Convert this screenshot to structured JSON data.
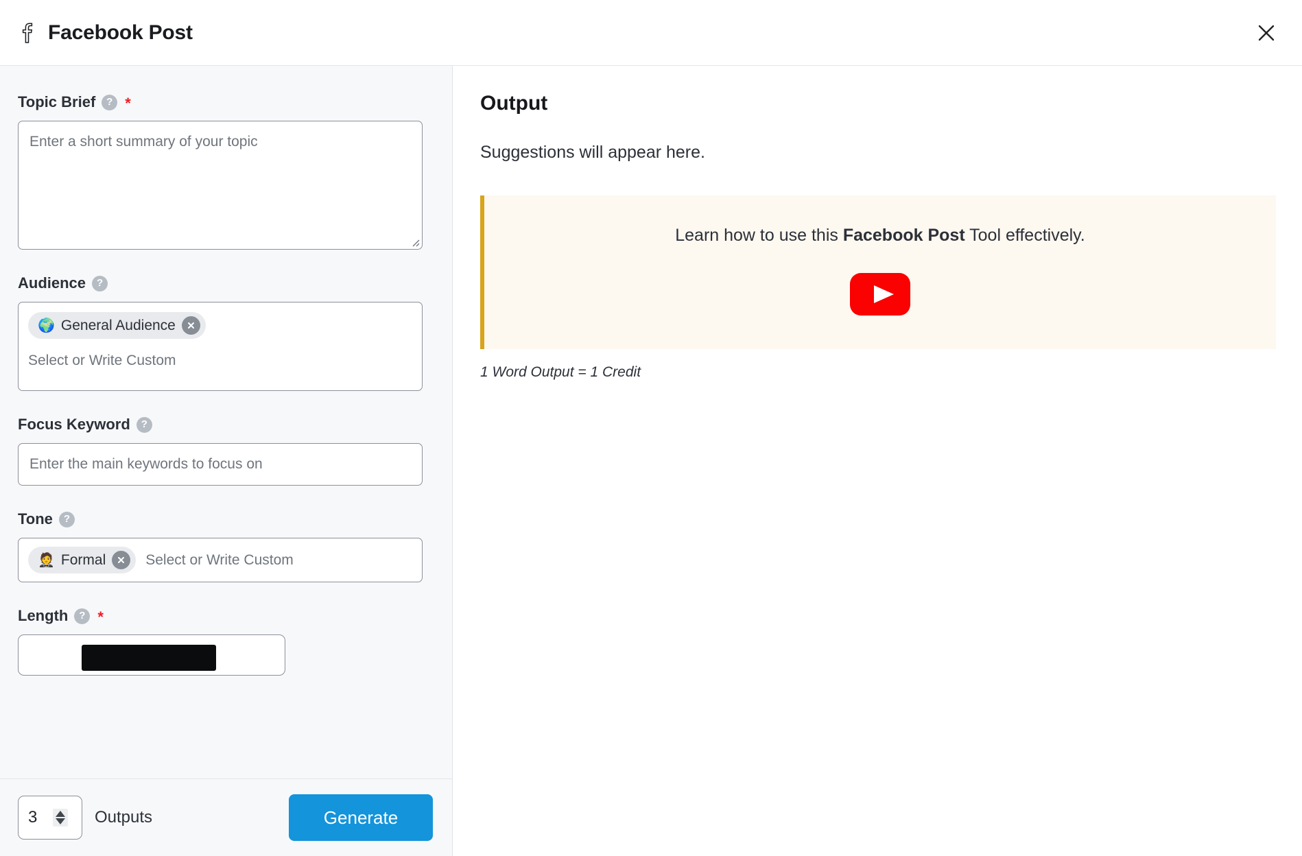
{
  "header": {
    "title": "Facebook Post",
    "brand_icon": "facebook-f-icon",
    "close_icon": "close-icon"
  },
  "form": {
    "topic_brief": {
      "label": "Topic Brief",
      "help_icon": "help-circle-icon",
      "required_marker": "*",
      "placeholder": "Enter a short summary of your topic",
      "value": ""
    },
    "audience": {
      "label": "Audience",
      "help_icon": "help-circle-icon",
      "placeholder": "Select or Write Custom",
      "chips": [
        {
          "emoji": "🌍",
          "label": "General Audience",
          "remove_icon": "chip-remove-icon"
        }
      ]
    },
    "focus_keyword": {
      "label": "Focus Keyword",
      "help_icon": "help-circle-icon",
      "placeholder": "Enter the main keywords to focus on",
      "value": ""
    },
    "tone": {
      "label": "Tone",
      "help_icon": "help-circle-icon",
      "placeholder": "Select or Write Custom",
      "chips": [
        {
          "emoji": "🤵",
          "label": "Formal",
          "remove_icon": "chip-remove-icon"
        }
      ]
    },
    "length": {
      "label": "Length",
      "help_icon": "help-circle-icon",
      "required_marker": "*"
    }
  },
  "footer": {
    "outputs_count": "3",
    "outputs_label": "Outputs",
    "generate_label": "Generate",
    "generate_color": "#1394db",
    "stepper_up_icon": "chevron-up-icon",
    "stepper_down_icon": "chevron-down-icon"
  },
  "output": {
    "title": "Output",
    "empty_message": "Suggestions will appear here.",
    "tip": {
      "prefix": "Learn how to use this ",
      "highlight": "Facebook Post",
      "suffix": " Tool effectively.",
      "video_icon": "youtube-play-icon",
      "accent_color": "#d9a41c",
      "background_color": "#fdf8f0"
    },
    "credit_note": "1 Word Output = 1 Credit"
  }
}
